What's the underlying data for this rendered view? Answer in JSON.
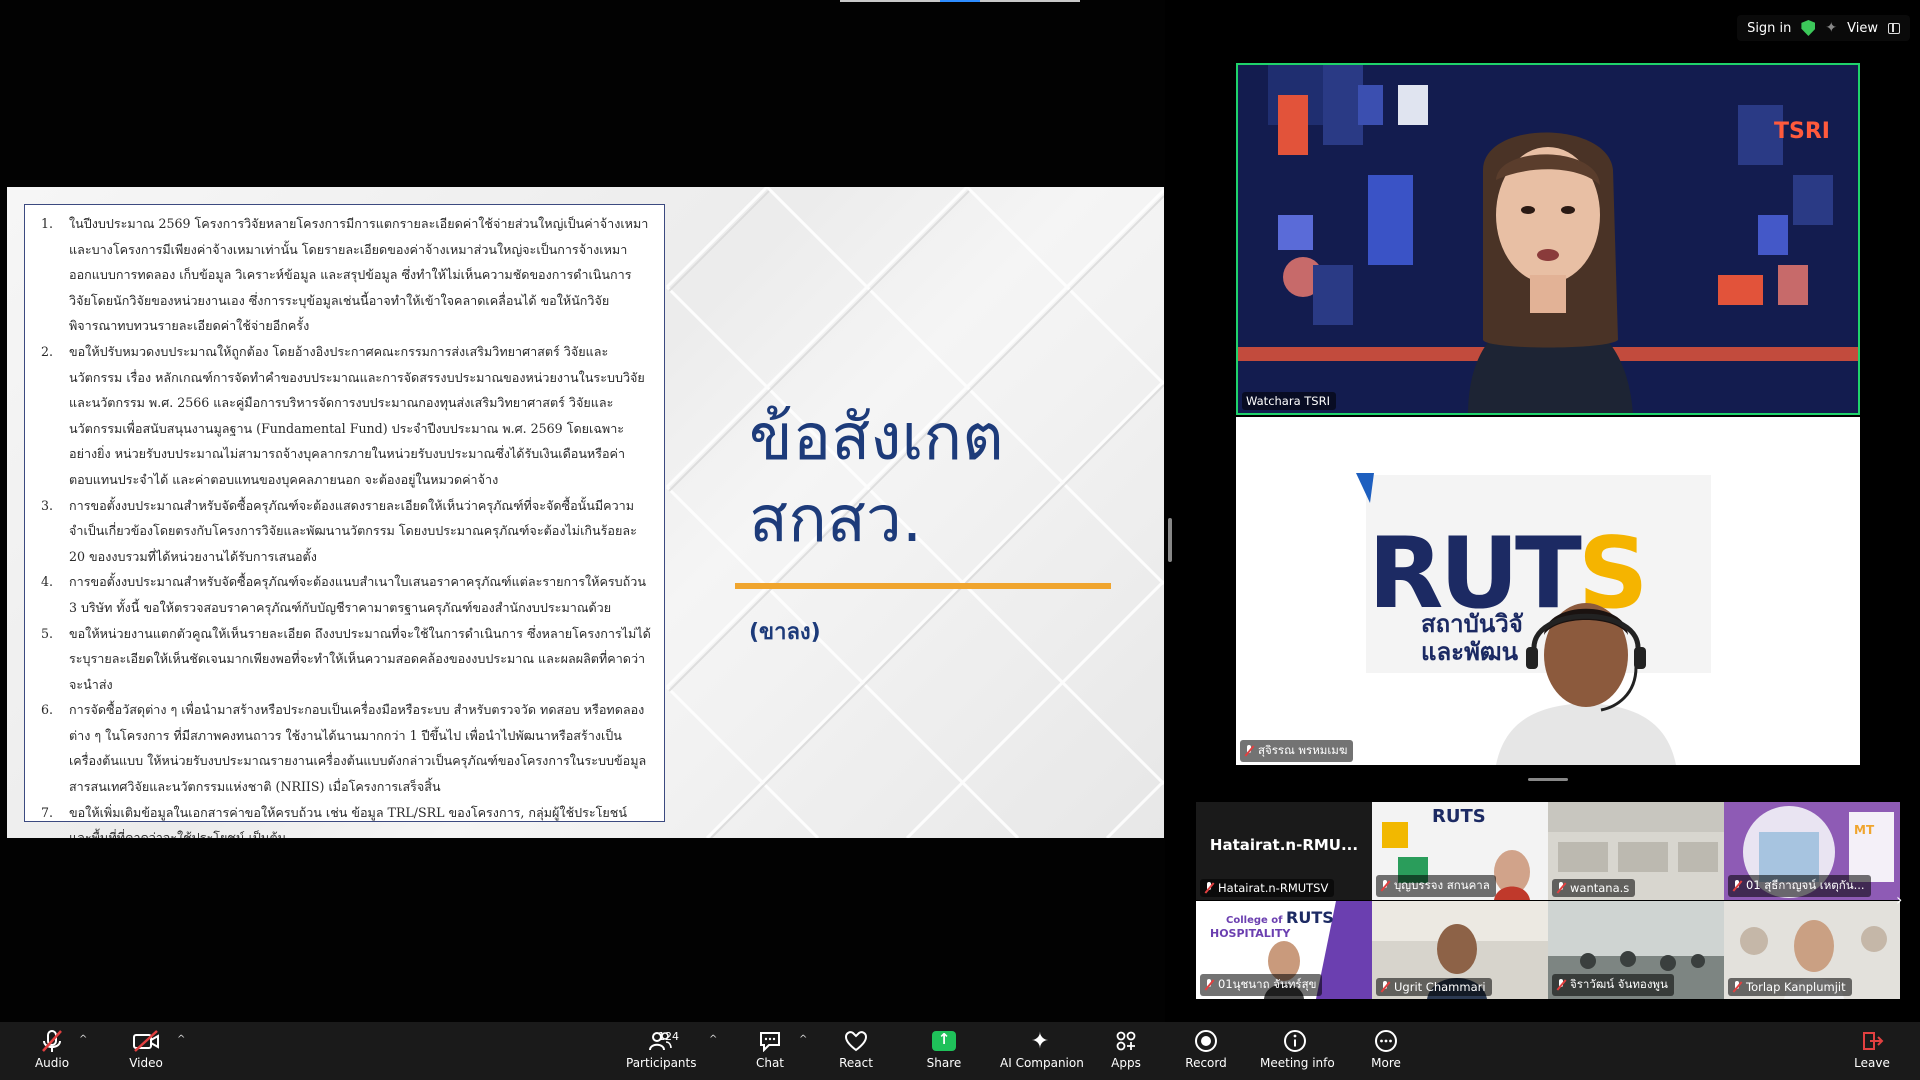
{
  "slide": {
    "items": [
      {
        "num": "1.",
        "text": "ในปีงบประมาณ 2569 โครงการวิจัยหลายโครงการมีการแตกรายละเอียดค่าใช้จ่ายส่วนใหญ่เป็นค่าจ้างเหมา และบางโครงการมีเพียงค่าจ้างเหมาเท่านั้น โดยรายละเอียดของค่าจ้างเหมาส่วนใหญ่จะเป็นการจ้างเหมาออกแบบการทดลอง เก็บข้อมูล วิเคราะห์ข้อมูล และสรุปข้อมูล ซึ่งทำให้ไม่เห็นความชัดของการดำเนินการวิจัยโดยนักวิจัยของหน่วยงานเอง ซึ่งการระบุข้อมูลเช่นนี้อาจทำให้เข้าใจคลาดเคลื่อนได้ ขอให้นักวิจัยพิจารณาทบทวนรายละเอียดค่าใช้จ่ายอีกครั้ง"
      },
      {
        "num": "2.",
        "text": "ขอให้ปรับหมวดงบประมาณให้ถูกต้อง โดยอ้างอิงประกาศคณะกรรมการส่งเสริมวิทยาศาสตร์ วิจัยและนวัตกรรม เรื่อง หลักเกณฑ์การจัดทำคำของบประมาณและการจัดสรรงบประมาณของหน่วยงานในระบบวิจัยและนวัตกรรม พ.ศ. 2566 และคู่มือการบริหารจัดการงบประมาณกองทุนส่งเสริมวิทยาศาสตร์ วิจัยและนวัตกรรมเพื่อสนับสนุนงานมูลฐาน (Fundamental Fund) ประจำปีงบประมาณ พ.ศ. 2569 โดยเฉพาะอย่างยิ่ง หน่วยรับงบประมาณไม่สามารถจ้างบุคลากรภายในหน่วยรับงบประมาณซึ่งได้รับเงินเดือนหรือค่าตอบแทนประจำได้ และค่าตอบแทนของบุคคลภายนอก จะต้องอยู่ในหมวดค่าจ้าง"
      },
      {
        "num": "3.",
        "text": "การขอตั้งงบประมาณสำหรับจัดซื้อครุภัณฑ์จะต้องแสดงรายละเอียดให้เห็นว่าครุภัณฑ์ที่จะจัดซื้อนั้นมีความจำเป็นเกี่ยวข้องโดยตรงกับโครงการวิจัยและพัฒนานวัตกรรม โดยงบประมาณครุภัณฑ์จะต้องไม่เกินร้อยละ 20 ของงบรวมที่ได้หน่วยงานได้รับการเสนอตั้ง"
      },
      {
        "num": "4.",
        "text": "การขอตั้งงบประมาณสำหรับจัดซื้อครุภัณฑ์จะต้องแนบสำเนาใบเสนอราคาครุภัณฑ์แต่ละรายการให้ครบถ้วน 3 บริษัท ทั้งนี้ ขอให้ตรวจสอบราคาครุภัณฑ์กับบัญชีราคามาตรฐานครุภัณฑ์ของสำนักงบประมาณด้วย"
      },
      {
        "num": "5.",
        "text": "ขอให้หน่วยงานแตกตัวคูณให้เห็นรายละเอียด ถึงงบประมาณที่จะใช้ในการดำเนินการ ซึ่งหลายโครงการไม่ได้ระบุรายละเอียดให้เห็นชัดเจนมากเพียงพอที่จะทำให้เห็นความสอดคล้องของงบประมาณ และผลผลิตที่คาดว่าจะนำส่ง"
      },
      {
        "num": "6.",
        "text": "การจัดซื้อวัสดุต่าง ๆ เพื่อนำมาสร้างหรือประกอบเป็นเครื่องมือหรือระบบ สำหรับตรวจวัด ทดสอบ หรือทดลองต่าง ๆ ในโครงการ ที่มีสภาพคงทนถาวร ใช้งานได้นานมากกว่า 1 ปีขึ้นไป เพื่อนำไปพัฒนาหรือสร้างเป็นเครื่องต้นแบบ ให้หน่วยรับงบประมาณรายงานเครื่องต้นแบบดังกล่าวเป็นครุภัณฑ์ของโครงการในระบบข้อมูลสารสนเทศวิจัยและนวัตกรรมแห่งชาติ (NRIIS) เมื่อโครงการเสร็จสิ้น"
      },
      {
        "num": "7.",
        "text": "ขอให้เพิ่มเติมข้อมูลในเอกสารค่าขอให้ครบถ้วน เช่น ข้อมูล TRL/SRL ของโครงการ, กลุ่มผู้ใช้ประโยชน์ และพื้นที่ที่คาดว่าจะใช้ประโยชน์ เป็นต้น"
      }
    ],
    "title_line1": "ข้อสังเกต",
    "title_line2": "สกสว.",
    "subtitle": "(ขาลง)"
  },
  "top_right": {
    "sign_in": "Sign in",
    "view": "View"
  },
  "speaker": {
    "name": "Watchara TSRI",
    "logo": "TSRI"
  },
  "second_tile": {
    "name": "สุจิรรณ พรหมเมฆ",
    "logo_word": "RUT",
    "logo_s": "S",
    "thai_line1": "สถาบันวิจั",
    "thai_line2": "และพัฒน"
  },
  "gallery": [
    {
      "name": "Hatairat.n-RMUTSV",
      "display": "Hatairat.n-RMU..."
    },
    {
      "name": "บุญบรรจง สกนคาล"
    },
    {
      "name": "wantana.s"
    },
    {
      "name": "01 สุธีกาญจน์ เหตุกัน..."
    },
    {
      "name": "01นุชนาถ จันทร์สุข"
    },
    {
      "name": "Ugrit Chammari"
    },
    {
      "name": "จิราวัฒน์ จันทองพูน"
    },
    {
      "name": "Torlap Kanplumjit"
    }
  ],
  "toolbar": {
    "audio": "Audio",
    "video": "Video",
    "participants": "Participants",
    "participants_count": "124",
    "chat": "Chat",
    "react": "React",
    "share": "Share",
    "ai": "AI Companion",
    "apps": "Apps",
    "record": "Record",
    "meeting_info": "Meeting info",
    "more": "More",
    "leave": "Leave"
  },
  "colors": {
    "accent_green": "#1fd36b",
    "slide_title": "#1d3b7a",
    "rule_orange": "#f0a52e",
    "share_green": "#1fc15a"
  }
}
